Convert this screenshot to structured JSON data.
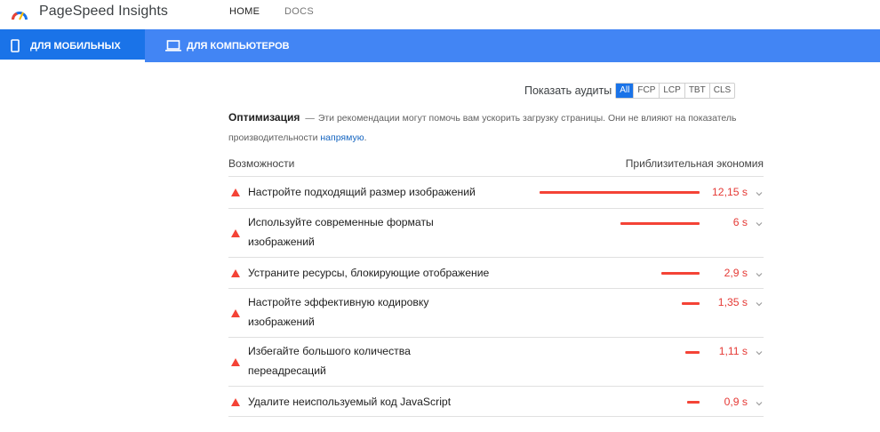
{
  "header": {
    "app_title": "PageSpeed Insights",
    "nav": [
      {
        "label": "HOME"
      },
      {
        "label": "DOCS"
      }
    ]
  },
  "device_tabs": [
    {
      "label": "ДЛЯ МОБИЛЬНЫХ",
      "icon": "mobile-icon",
      "active": true
    },
    {
      "label": "ДЛЯ КОМПЬЮТЕРОВ",
      "icon": "laptop-icon",
      "active": false
    }
  ],
  "filter": {
    "label": "Показать аудиты",
    "chips": [
      "All",
      "FCP",
      "LCP",
      "TBT",
      "CLS"
    ],
    "active": "All"
  },
  "section": {
    "title": "Оптимизация",
    "dash": "—",
    "description": "Эти рекомендации могут помочь вам ускорить загрузку страницы. Они не влияют на показатель производительности",
    "link_text": "напрямую",
    "period": "."
  },
  "table": {
    "col_left": "Возможности",
    "col_right": "Приблизительная экономия",
    "rows": [
      {
        "title": "Настройте подходящий размер изображений",
        "value": "12,15 s",
        "savings_seconds": 12.15
      },
      {
        "title": "Используйте современные форматы изображений",
        "value": "6 s",
        "savings_seconds": 6
      },
      {
        "title": "Устраните ресурсы, блокирующие отображение",
        "value": "2,9 s",
        "savings_seconds": 2.9
      },
      {
        "title": "Настройте эффективную кодировку изображений",
        "value": "1,35 s",
        "savings_seconds": 1.35
      },
      {
        "title": "Избегайте большого количества переадресаций",
        "value": "1,11 s",
        "savings_seconds": 1.11
      },
      {
        "title": "Удалите неиспользуемый код JavaScript",
        "value": "0,9 s",
        "savings_seconds": 0.9
      }
    ]
  },
  "colors": {
    "brand_blue": "#4285f4",
    "active_tab": "#1a73e8",
    "warning": "#f44336",
    "link": "#1565c0"
  }
}
